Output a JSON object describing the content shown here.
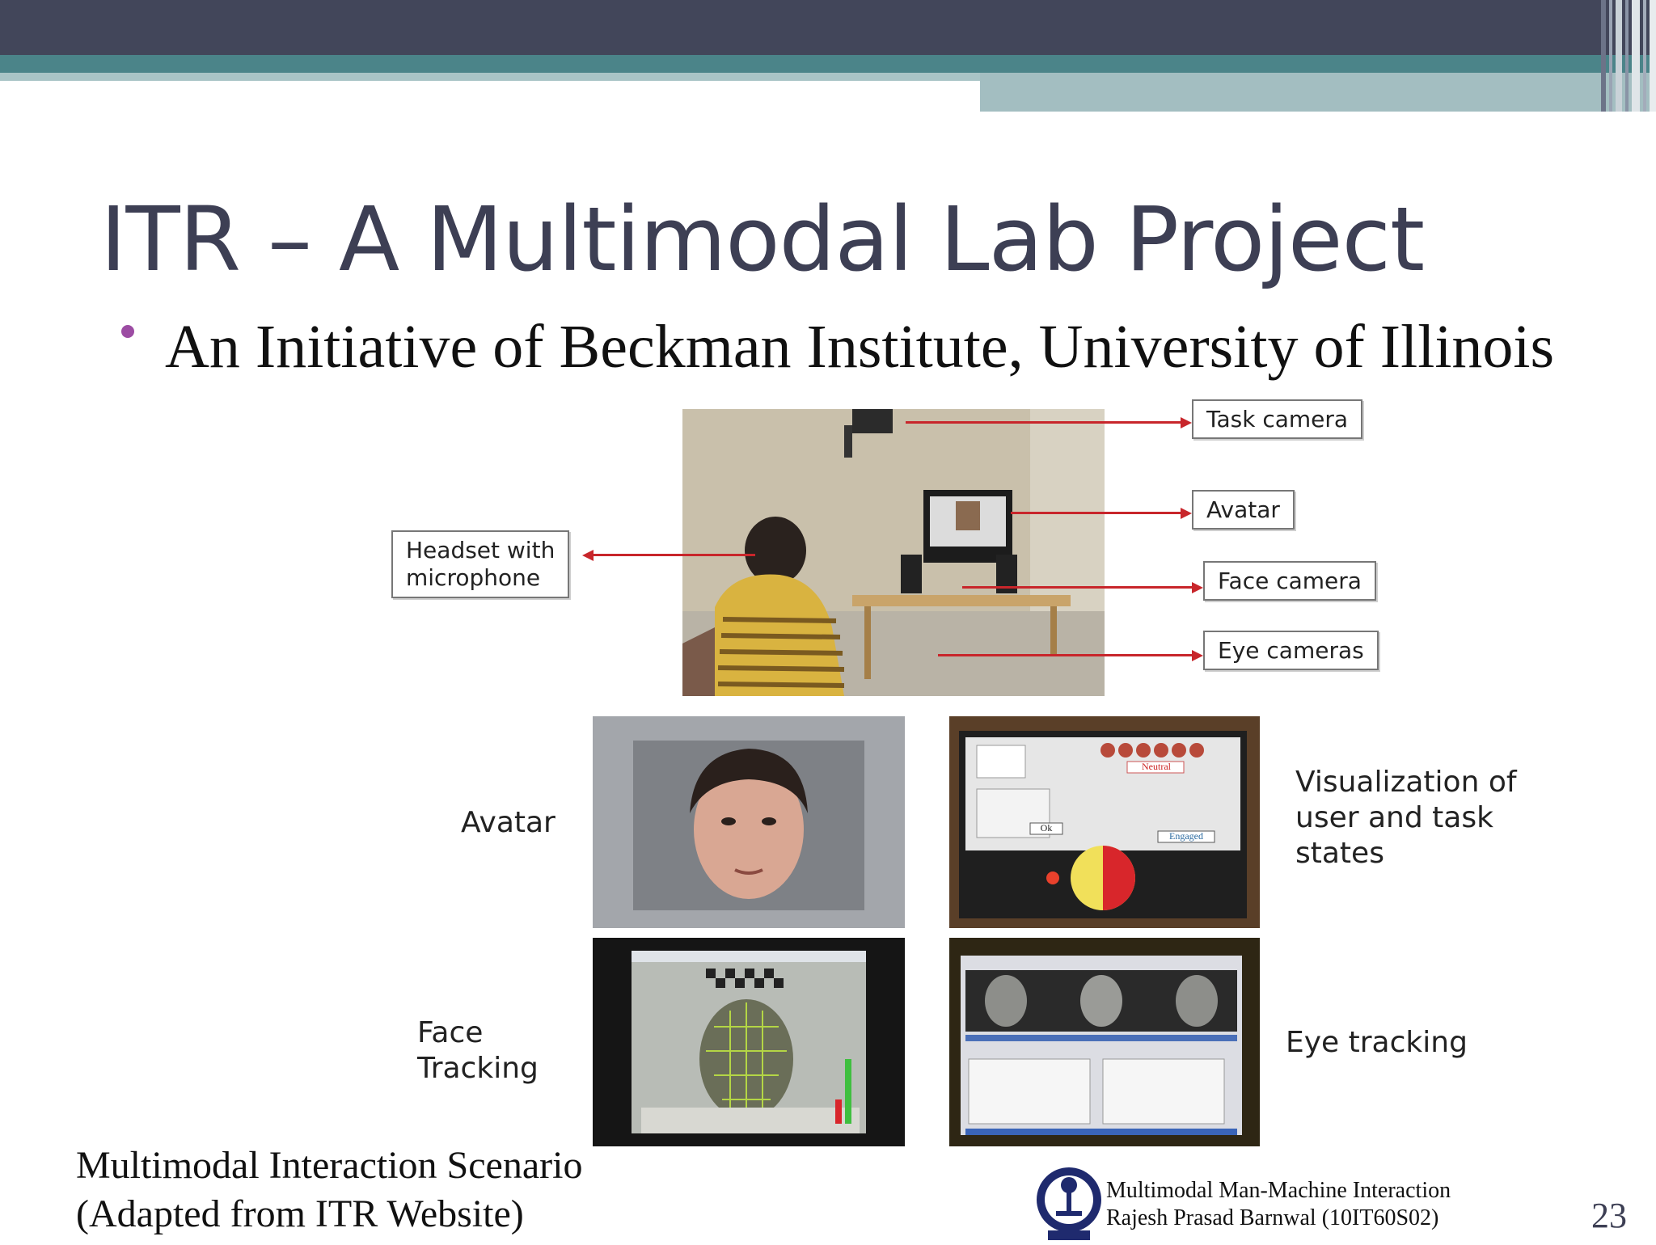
{
  "slide": {
    "title": "ITR – A Multimodal Lab Project",
    "bullet": "An Initiative of Beckman Institute, University of Illinois",
    "caption_line1": "Multimodal Interaction Scenario",
    "caption_line2": "(Adapted from ITR Website)",
    "footer_line1": "Multimodal Man-Machine Interaction",
    "footer_line2": "Rajesh Prasad Barnwal (10IT60S02)",
    "page_number": "23"
  },
  "figure": {
    "callouts": {
      "task_camera": "Task camera",
      "avatar": "Avatar",
      "face_camera": "Face camera",
      "eye_cameras": "Eye cameras",
      "headset_line1": "Headset with",
      "headset_line2": "microphone"
    },
    "labels": {
      "avatar": "Avatar",
      "visualization_line1": "Visualization of",
      "visualization_line2": "user and task",
      "visualization_line3": "states",
      "face_tracking_line1": "Face",
      "face_tracking_line2": "Tracking",
      "eye_tracking": "Eye tracking"
    },
    "screen_labels": {
      "neutral": "Neutral",
      "ok": "Ok",
      "engaged": "Engaged"
    }
  },
  "colors": {
    "header_dark": "#42465a",
    "header_teal": "#4b8489",
    "title_text": "#3d3f54",
    "bullet_accent": "#9c4ca3",
    "callout_arrow": "#c8262b"
  },
  "icons": {
    "logo": "institute-emblem-icon"
  }
}
